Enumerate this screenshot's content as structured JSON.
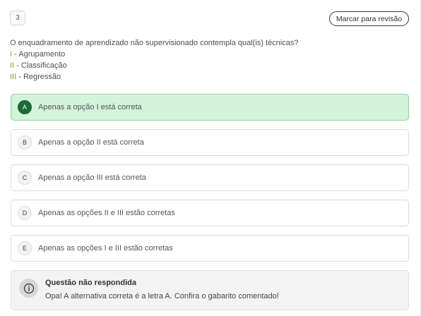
{
  "question": {
    "number": "3",
    "review_button_label": "Marcar para revisão",
    "prompt": "O enquadramento de aprendizado não supervisionado contempla qual(is) técnicas?",
    "items": [
      {
        "numeral": "I",
        "separator": " - ",
        "text": "Agrupamento"
      },
      {
        "numeral": "II",
        "separator": " - ",
        "text": "Classificação"
      },
      {
        "numeral": "III",
        "separator": " - ",
        "text": "Regressão"
      }
    ]
  },
  "options": [
    {
      "letter": "A",
      "text": "Apenas a opção I está correta",
      "state": "correct"
    },
    {
      "letter": "B",
      "text": "Apenas a opção II está correta",
      "state": "default"
    },
    {
      "letter": "C",
      "text": "Apenas a opção III está correta",
      "state": "default"
    },
    {
      "letter": "D",
      "text": "Apenas as opções II e III estão corretas",
      "state": "default"
    },
    {
      "letter": "E",
      "text": "Apenas as opções I e III estão corretas",
      "state": "default"
    }
  ],
  "feedback": {
    "icon": "info-icon",
    "title": "Questão não respondida",
    "message": "Opa! A alternativa correta é a letra A. Confira o gabarito comentado!"
  },
  "colors": {
    "correct_bg": "#d3f3da",
    "correct_border": "#8ed69c",
    "correct_badge": "#1c6b37",
    "numeral_accent": "#8a9a1e"
  }
}
